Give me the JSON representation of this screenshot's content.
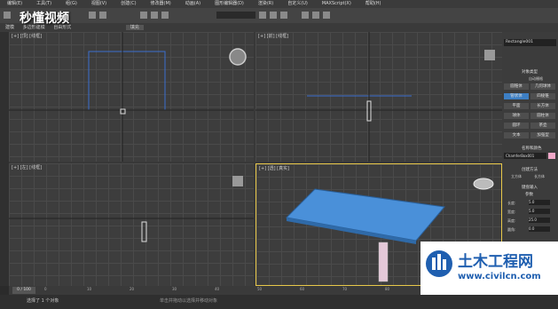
{
  "app": {
    "name": "3ds Max"
  },
  "menu": [
    "编辑(E)",
    "工具(T)",
    "组(G)",
    "视图(V)",
    "创建(C)",
    "修改器(M)",
    "动画(A)",
    "图形编辑器(D)",
    "渲染(R)",
    "自定义(U)",
    "MAXScript(X)",
    "帮助(H)"
  ],
  "subbar": {
    "left_label": "建模",
    "selection_mode_1": "多边形建模",
    "selection_mode_2": "自由形式",
    "field": "填充"
  },
  "overlay_logo": {
    "text": "秒懂视频"
  },
  "viewports": [
    {
      "id": "top",
      "label": "[+] [顶] [线框]"
    },
    {
      "id": "front",
      "label": "[+] [前] [线框]"
    },
    {
      "id": "left",
      "label": "[+] [左] [线框]"
    },
    {
      "id": "perspective",
      "label": "[+] [透] [真实]"
    }
  ],
  "command_panel": {
    "object_name": "Rectangle001",
    "section_object_type": "对象类型",
    "autogrid": "自动栅格",
    "buttons": [
      "圆锥体",
      "几何球体",
      "管状体",
      "四棱锥",
      "平面",
      "长方体",
      "球体",
      "圆柱体",
      "圆环",
      "茶壶",
      "文本",
      "加强型"
    ],
    "section_name_color": "名称和颜色",
    "name_value": "ChamferBox001",
    "section_creation_method": "创建方法",
    "creation_options": [
      "立方体",
      "长方体"
    ],
    "section_keyboard": "键盘输入",
    "section_parameters": "参数",
    "param_labels": [
      "长度:",
      "宽度:",
      "高度:",
      "圆角:"
    ],
    "param_values": [
      "5.0",
      "5.0",
      "25.0",
      "0.0"
    ]
  },
  "timeline": {
    "position": "0 / 100",
    "ticks": [
      "0",
      "10",
      "20",
      "30",
      "40",
      "50",
      "60",
      "70",
      "80",
      "90",
      "100"
    ]
  },
  "statusbar": {
    "selection": "选择了 1 个对象",
    "hint": "单击并拖动以选择并移动对象"
  },
  "watermark": {
    "brand": "土木工程网",
    "url": "www.civilcn.com"
  },
  "colors": {
    "viewport_bg": "#3d3d3d",
    "active_border": "#e8c84a",
    "table_top": "#4a90d9",
    "active_button": "#3d7fc4"
  }
}
